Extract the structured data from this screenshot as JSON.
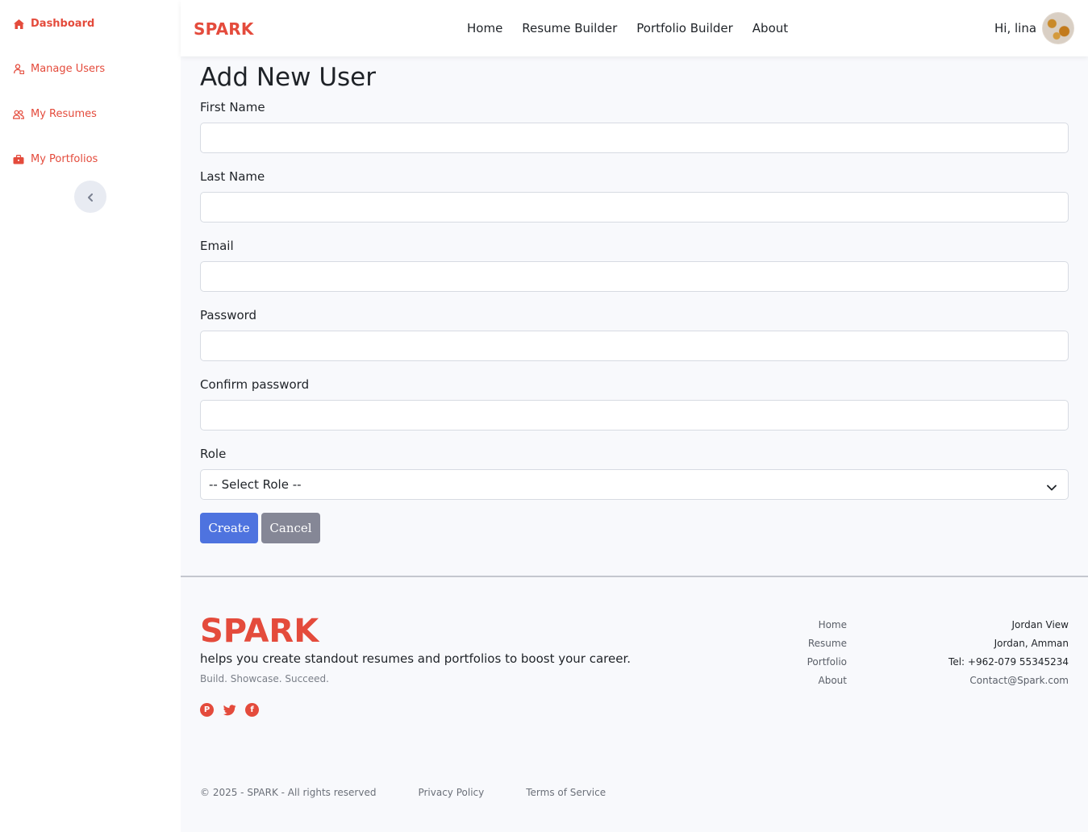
{
  "sidebar": {
    "items": [
      {
        "label": "Dashboard",
        "icon": "home-icon"
      },
      {
        "label": "Manage Users",
        "icon": "user-manage-icon"
      },
      {
        "label": "My Resumes",
        "icon": "users-icon"
      },
      {
        "label": "My Portfolios",
        "icon": "briefcase-icon"
      }
    ],
    "collapse_icon": "chevron-left-icon"
  },
  "header": {
    "brand": "SPARK",
    "nav": [
      "Home",
      "Resume Builder",
      "Portfolio Builder",
      "About"
    ],
    "greeting": "Hi, lina"
  },
  "form": {
    "title": "Add New User",
    "fields": [
      {
        "label": "First Name",
        "value": ""
      },
      {
        "label": "Last Name",
        "value": ""
      },
      {
        "label": "Email",
        "value": ""
      },
      {
        "label": "Password",
        "value": ""
      },
      {
        "label": "Confirm password",
        "value": ""
      }
    ],
    "role": {
      "label": "Role",
      "selected": "-- Select Role --"
    },
    "create_label": "Create",
    "cancel_label": "Cancel"
  },
  "footer": {
    "brand": "SPARK",
    "tagline": "helps you create standout resumes and portfolios to boost your career.",
    "motto": "Build. Showcase. Succeed.",
    "socials": [
      "pinterest-icon",
      "twitter-icon",
      "facebook-icon"
    ],
    "links": [
      "Home",
      "Resume",
      "Portfolio",
      "About"
    ],
    "contact": [
      "Jordan View",
      "Jordan, Amman",
      "Tel: +962-079 55345234",
      "Contact@Spark.com"
    ],
    "copyright": "© 2025 - SPARK - All rights reserved",
    "privacy": "Privacy Policy",
    "terms": "Terms of Service"
  },
  "colors": {
    "brand": "#e44b3c",
    "primary": "#4e73df",
    "secondary": "#858796"
  }
}
